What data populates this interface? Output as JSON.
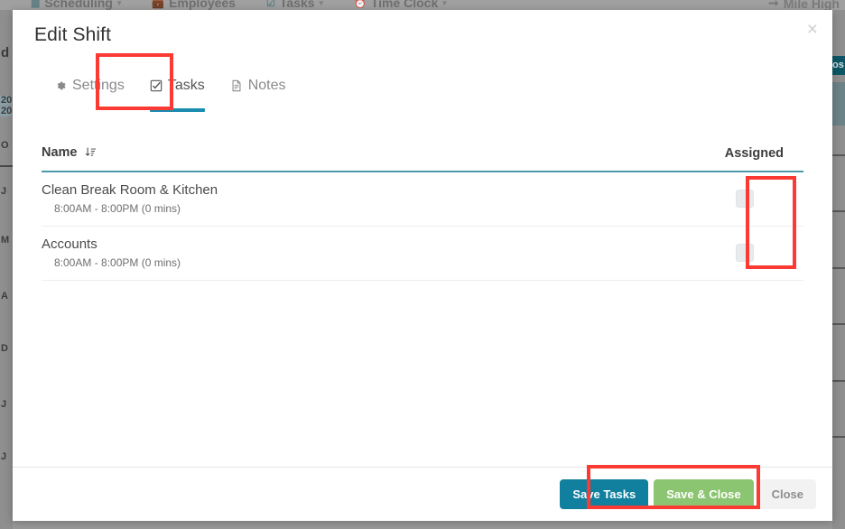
{
  "background": {
    "navbar": {
      "left_items": [
        {
          "label": "Scheduling",
          "icon": "calendar-icon",
          "caret": "▾"
        },
        {
          "label": "Employees",
          "icon": "briefcase-icon",
          "caret": ""
        },
        {
          "label": "Tasks",
          "icon": "check-circle-icon",
          "caret": "▾"
        },
        {
          "label": "Time Clock",
          "icon": "clock-icon",
          "caret": "▾"
        }
      ],
      "right_label": "Mile High",
      "right_icon": "arrow-icon"
    },
    "left_strip_fragments": [
      "d",
      "20",
      "20",
      "O",
      "J",
      "M",
      "A",
      "D",
      "J",
      "J"
    ],
    "right_button_fragment": "os"
  },
  "modal": {
    "title": "Edit Shift",
    "close_icon": "×",
    "tabs": [
      {
        "label": "Settings",
        "icon": "gear-icon",
        "glyph": "⚙",
        "active": false
      },
      {
        "label": "Tasks",
        "icon": "check-square-icon",
        "glyph": "☑",
        "active": true
      },
      {
        "label": "Notes",
        "icon": "document-icon",
        "glyph": "὜e",
        "active": false
      }
    ],
    "table": {
      "columns": [
        "Name",
        "Assigned"
      ],
      "sort_icon": "sort-amount-down-icon",
      "rows": [
        {
          "name": "Clean Break Room & Kitchen",
          "time": "8:00AM - 8:00PM (0 mins)",
          "assigned": false
        },
        {
          "name": "Accounts",
          "time": "8:00AM - 8:00PM (0 mins)",
          "assigned": false
        }
      ]
    },
    "footer": {
      "save_tasks_label": "Save Tasks",
      "save_close_label": "Save & Close",
      "close_label": "Close"
    }
  },
  "colors": {
    "accent_teal": "#1a8cb0",
    "save_tasks": "#10809e",
    "save_close": "#8cc571",
    "close": "#f2f2f2",
    "annotation_red": "#fb3b33",
    "table_header_rule": "#4c99ab"
  }
}
